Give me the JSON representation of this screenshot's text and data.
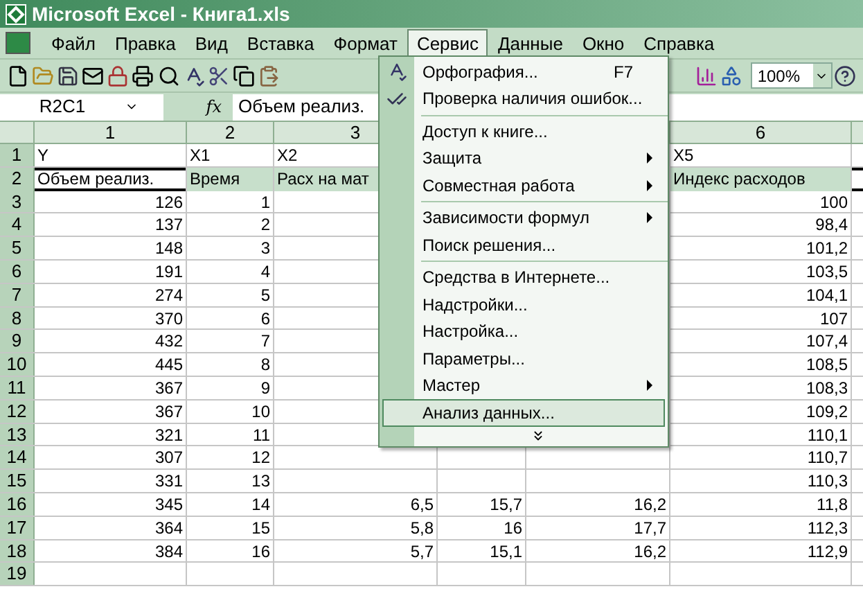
{
  "window": {
    "title": "Microsoft Excel - Книга1.xls"
  },
  "menu_bar": [
    {
      "label": "Файл",
      "selected": false
    },
    {
      "label": "Правка",
      "selected": false
    },
    {
      "label": "Вид",
      "selected": false
    },
    {
      "label": "Вставка",
      "selected": false
    },
    {
      "label": "Формат",
      "selected": false
    },
    {
      "label": "Сервис",
      "selected": true
    },
    {
      "label": "Данные",
      "selected": false
    },
    {
      "label": "Окно",
      "selected": false
    },
    {
      "label": "Справка",
      "selected": false
    }
  ],
  "toolbar": {
    "zoom": "100%"
  },
  "formula_bar": {
    "name_box": "R2C1",
    "fx": "fx",
    "value": "Объем реализ."
  },
  "columns": [
    "1",
    "2",
    "3",
    null,
    null,
    "6"
  ],
  "rows": [
    {
      "header": "1",
      "selected": false,
      "cells": [
        "Y",
        "X1",
        "X2",
        null,
        null,
        "X5"
      ]
    },
    {
      "header": "2",
      "selected": true,
      "cells": [
        "Объем реализ.",
        "Время",
        "Расх на мат",
        null,
        null,
        "Индекс расходов"
      ]
    },
    {
      "header": "3",
      "selected": false,
      "cells": [
        "126",
        "1",
        null,
        null,
        null,
        "100"
      ]
    },
    {
      "header": "4",
      "selected": false,
      "cells": [
        "137",
        "2",
        null,
        null,
        null,
        "98,4"
      ]
    },
    {
      "header": "5",
      "selected": false,
      "cells": [
        "148",
        "3",
        null,
        null,
        null,
        "101,2"
      ]
    },
    {
      "header": "6",
      "selected": false,
      "cells": [
        "191",
        "4",
        null,
        null,
        null,
        "103,5"
      ]
    },
    {
      "header": "7",
      "selected": false,
      "cells": [
        "274",
        "5",
        null,
        null,
        null,
        "104,1"
      ]
    },
    {
      "header": "8",
      "selected": false,
      "cells": [
        "370",
        "6",
        null,
        null,
        null,
        "107"
      ]
    },
    {
      "header": "9",
      "selected": false,
      "cells": [
        "432",
        "7",
        null,
        null,
        null,
        "107,4"
      ]
    },
    {
      "header": "10",
      "selected": false,
      "cells": [
        "445",
        "8",
        null,
        null,
        null,
        "108,5"
      ]
    },
    {
      "header": "11",
      "selected": false,
      "cells": [
        "367",
        "9",
        null,
        null,
        null,
        "108,3"
      ]
    },
    {
      "header": "12",
      "selected": false,
      "cells": [
        "367",
        "10",
        null,
        null,
        null,
        "109,2"
      ]
    },
    {
      "header": "13",
      "selected": false,
      "cells": [
        "321",
        "11",
        null,
        null,
        null,
        "110,1"
      ]
    },
    {
      "header": "14",
      "selected": false,
      "cells": [
        "307",
        "12",
        null,
        null,
        null,
        "110,7"
      ]
    },
    {
      "header": "15",
      "selected": false,
      "cells": [
        "331",
        "13",
        null,
        null,
        null,
        "110,3"
      ]
    },
    {
      "header": "16",
      "selected": false,
      "cells": [
        "345",
        "14",
        "6,5",
        "15,7",
        "16,2",
        "11,8"
      ]
    },
    {
      "header": "17",
      "selected": false,
      "cells": [
        "364",
        "15",
        "5,8",
        "16",
        "17,7",
        "112,3"
      ]
    },
    {
      "header": "18",
      "selected": false,
      "cells": [
        "384",
        "16",
        "5,7",
        "15,1",
        "16,2",
        "112,9"
      ]
    },
    {
      "header": "19",
      "selected": false,
      "cells": [
        null,
        null,
        null,
        null,
        null,
        null
      ]
    }
  ],
  "dropdown_menu": {
    "items": [
      {
        "kind": "item",
        "label": "Орфография...",
        "shortcut": "F7",
        "submenu": false,
        "selected": false
      },
      {
        "kind": "item",
        "label": "Проверка наличия ошибок...",
        "submenu": false,
        "selected": false
      },
      {
        "kind": "separator"
      },
      {
        "kind": "item",
        "label": "Доступ к книге...",
        "submenu": false,
        "selected": false
      },
      {
        "kind": "item",
        "label": "Защита",
        "submenu": true,
        "selected": false
      },
      {
        "kind": "item",
        "label": "Совместная работа",
        "submenu": true,
        "selected": false
      },
      {
        "kind": "separator"
      },
      {
        "kind": "item",
        "label": "Зависимости формул",
        "submenu": true,
        "selected": false
      },
      {
        "kind": "item",
        "label": "Поиск решения...",
        "submenu": false,
        "selected": false
      },
      {
        "kind": "separator"
      },
      {
        "kind": "item",
        "label": "Средства в Интернете...",
        "submenu": false,
        "selected": false
      },
      {
        "kind": "item",
        "label": "Надстройки...",
        "submenu": false,
        "selected": false
      },
      {
        "kind": "item",
        "label": "Настройка...",
        "submenu": false,
        "selected": false
      },
      {
        "kind": "item",
        "label": "Параметры...",
        "submenu": false,
        "selected": false
      },
      {
        "kind": "item",
        "label": "Мастер",
        "submenu": true,
        "selected": false
      },
      {
        "kind": "item",
        "label": "Анализ данных...",
        "submenu": false,
        "selected": true
      },
      {
        "kind": "expand"
      }
    ]
  }
}
